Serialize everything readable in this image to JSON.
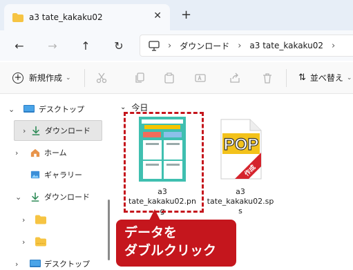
{
  "tab": {
    "title": "a3 tate_kakaku02",
    "close": "✕",
    "new_tab": "+"
  },
  "nav": {
    "back": "←",
    "forward": "→",
    "up": "↑",
    "refresh": "↻",
    "breadcrumb": [
      "ダウンロード",
      "a3 tate_kakaku02"
    ]
  },
  "toolbar": {
    "new_label": "新規作成",
    "sort_label": "並べ替え"
  },
  "sidebar": {
    "items": [
      {
        "label": "デスクトップ",
        "icon": "desktop-icon"
      },
      {
        "label": "ダウンロード",
        "icon": "download-icon"
      },
      {
        "label": "ホーム",
        "icon": "home-icon"
      },
      {
        "label": "ギャラリー",
        "icon": "gallery-icon"
      },
      {
        "label": "ダウンロード",
        "icon": "download-icon"
      },
      {
        "label": "",
        "icon": "folder-icon"
      },
      {
        "label": "",
        "icon": "folder-icon"
      },
      {
        "label": "デスクトップ",
        "icon": "desktop-icon"
      }
    ]
  },
  "content": {
    "group": "今日",
    "files": [
      {
        "name_line1": "a3",
        "name_line2": "tate_kakaku02.pn",
        "name_line3": "g"
      },
      {
        "name_line1": "a3",
        "name_line2": "tate_kakaku02.sp",
        "name_line3": "s",
        "pop_text": "POP",
        "banner_text": "作成"
      }
    ]
  },
  "callout": {
    "line1": "データを",
    "line2": "ダブルクリック"
  },
  "colors": {
    "accent_red": "#c5161d",
    "folder": "#f6c443",
    "download": "#2e8b57",
    "tab_strip": "#e7eef7"
  }
}
